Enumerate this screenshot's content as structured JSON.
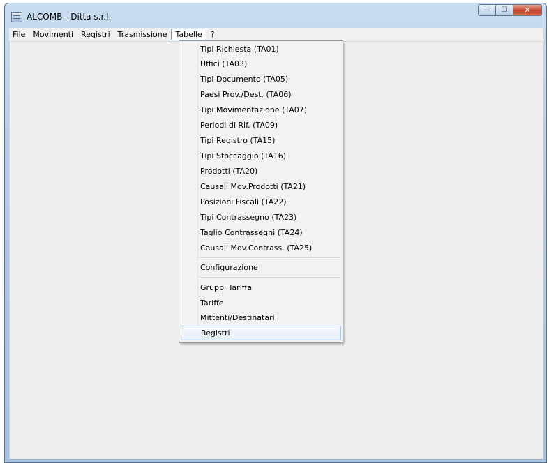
{
  "window": {
    "title": "ALCOMB - Ditta s.r.l.",
    "buttons": {
      "minimize": "—",
      "maximize": "☐",
      "close": "✕"
    }
  },
  "menubar": {
    "items": [
      "File",
      "Movimenti",
      "Registri",
      "Trasmissione",
      "Tabelle",
      "?"
    ],
    "active": "Tabelle"
  },
  "dropdown": {
    "group1": [
      "Tipi Richiesta (TA01)",
      "Uffici (TA03)",
      "Tipi Documento (TA05)",
      "Paesi Prov./Dest. (TA06)",
      "Tipi Movimentazione (TA07)",
      "Periodi di Rif. (TA09)",
      "Tipi Registro (TA15)",
      "Tipi Stoccaggio (TA16)",
      "Prodotti (TA20)",
      "Causali Mov.Prodotti (TA21)",
      "Posizioni Fiscali (TA22)",
      "Tipi Contrassegno (TA23)",
      "Taglio Contrassegni (TA24)",
      "Causali Mov.Contrass. (TA25)"
    ],
    "group2": [
      "Configurazione"
    ],
    "group3": [
      "Gruppi Tariffa",
      "Tariffe",
      "Mittenti/Destinatari",
      "Registri"
    ],
    "highlighted": "Registri"
  },
  "colors": {
    "highlight_border": "#a8c4e6",
    "titlebar": "#b6cde6",
    "close_button": "#c8452d"
  }
}
